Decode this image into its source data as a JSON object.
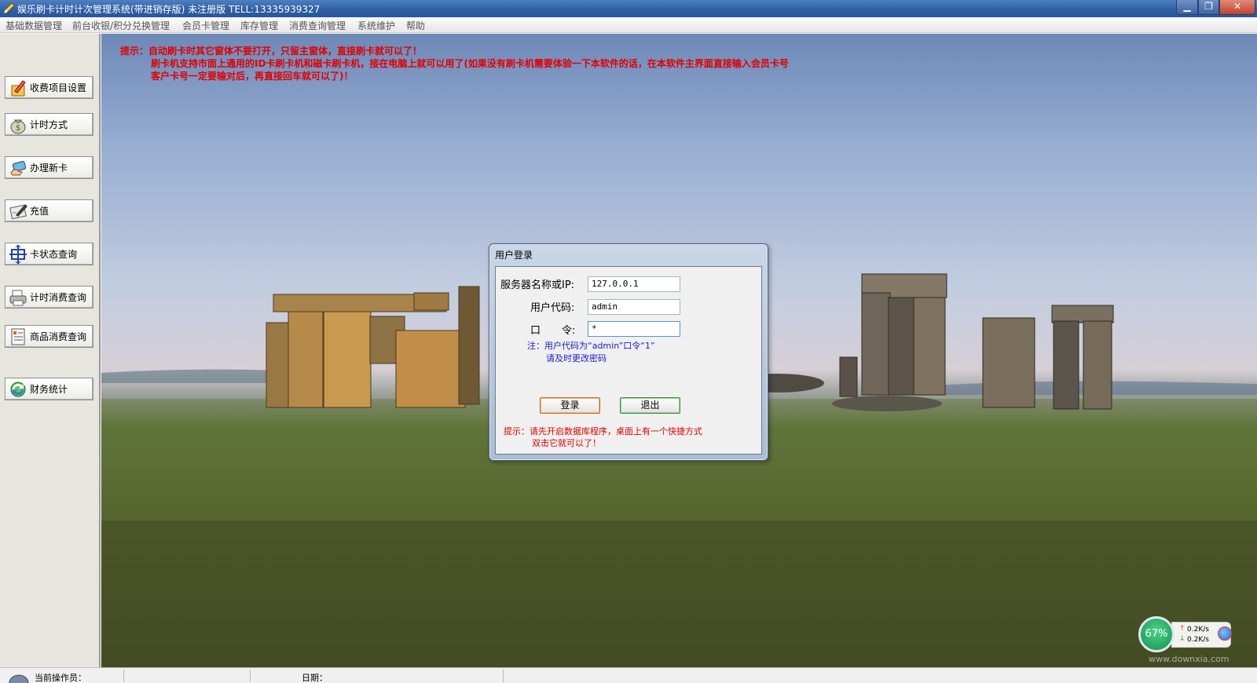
{
  "window": {
    "title": "娱乐刷卡计时计次管理系统(带进销存版) 未注册版 TELL:13335939327",
    "minimize_glyph": "▁",
    "maximize_glyph": "❐",
    "close_glyph": "✕"
  },
  "menu": [
    "基础数据管理",
    "前台收银/积分兑换管理",
    "会员卡管理",
    "库存管理",
    "消费查询管理",
    "系统维护",
    "帮助"
  ],
  "sidebar": {
    "items": [
      {
        "label": "收费项目设置",
        "icon": "pencil-folder-icon"
      },
      {
        "label": "计时方式",
        "icon": "money-bag-icon"
      },
      {
        "label": "办理新卡",
        "icon": "card-hand-icon"
      },
      {
        "label": "充值",
        "icon": "pen-document-icon"
      },
      {
        "label": "卡状态查询",
        "icon": "card-status-icon"
      },
      {
        "label": "计时消费查询",
        "icon": "printer-icon"
      },
      {
        "label": "商品消费查询",
        "icon": "document-list-icon"
      },
      {
        "label": "财务统计",
        "icon": "globe-refresh-icon"
      }
    ]
  },
  "hint": {
    "line1": "提示：自动刷卡时其它窗体不要打开，只留主窗体，直接刷卡就可以了！",
    "line2": "刷卡机支持市面上通用的ID卡刷卡机和磁卡刷卡机，接在电脑上就可以用了(如果没有刷卡机需要体验一下本软件的话，在本软件主界面直接输入会员卡号",
    "line3": "客户卡号一定要输对后，再直接回车就可以了)！"
  },
  "login": {
    "title": "用户登录",
    "server_label": "服务器名称或IP:",
    "server_value": "127.0.0.1",
    "user_label": "用户代码:",
    "user_value": "admin",
    "password_label_a": "口",
    "password_label_b": "令:",
    "password_value": "*",
    "note_line1": "注：用户代码为“admin”口令“1”",
    "note_line2": "请及时更改密码",
    "login_button": "登录",
    "exit_button": "退出",
    "warning_line1": "提示：请先开启数据库程序，桌面上有一个快捷方式",
    "warning_line2": "双击它就可以了！"
  },
  "status": {
    "operator_label": "当前操作员：",
    "date_label": "日期："
  },
  "network": {
    "percent": "67%",
    "upload": "0.2K/s",
    "download": "0.2K/s",
    "up_arrow": "↑",
    "down_arrow": "↓"
  },
  "watermark": "www.downxia.com",
  "colors": {
    "hint_red": "#e00000",
    "note_blue": "#1a1ad8",
    "titlebar_blue": "#2c5da3"
  }
}
